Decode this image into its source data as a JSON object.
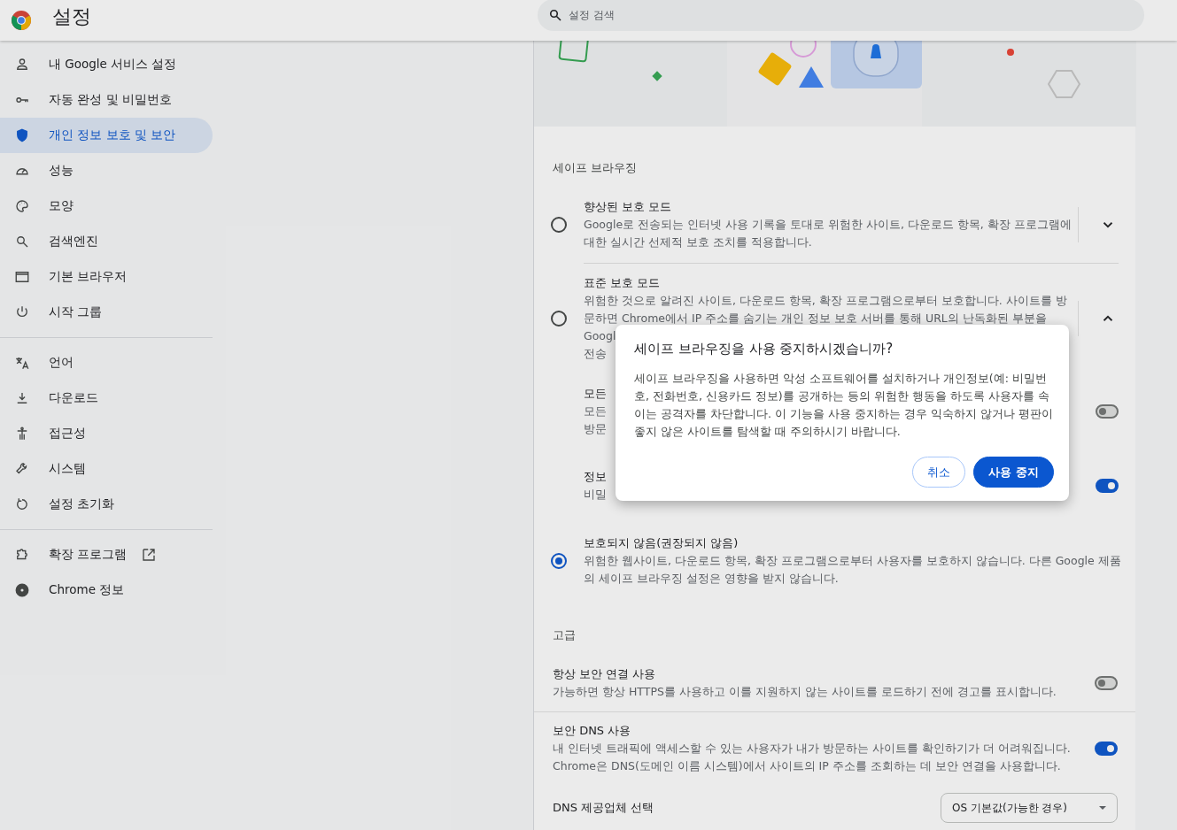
{
  "header": {
    "title": "설정",
    "search": {
      "placeholder": "설정 검색"
    }
  },
  "sidebar": {
    "groups": [
      [
        {
          "label": "내 Google 서비스 설정",
          "selected": false
        },
        {
          "label": "자동 완성 및 비밀번호",
          "selected": false
        },
        {
          "label": "개인 정보 보호 및 보안",
          "selected": true
        },
        {
          "label": "성능",
          "selected": false
        },
        {
          "label": "모양",
          "selected": false
        },
        {
          "label": "검색엔진",
          "selected": false
        },
        {
          "label": "기본 브라우저",
          "selected": false
        },
        {
          "label": "시작 그룹",
          "selected": false
        }
      ],
      [
        {
          "label": "언어",
          "selected": false
        },
        {
          "label": "다운로드",
          "selected": false
        },
        {
          "label": "접근성",
          "selected": false
        },
        {
          "label": "시스템",
          "selected": false
        },
        {
          "label": "설정 초기화",
          "selected": false
        }
      ],
      [
        {
          "label": "확장 프로그램",
          "selected": false,
          "external": true
        },
        {
          "label": "Chrome 정보",
          "selected": false
        }
      ]
    ]
  },
  "safe_browsing": {
    "heading": "세이프 브라우징",
    "options": [
      {
        "title": "향상된 보호 모드",
        "description_lines": [
          "Google로 전송되는 인터넷 사용 기록을 토대로 위험한 사이트, 다운로드 항목, 확장 프로그램에",
          "대한 실시간 선제적 보호 조치를 적용합니다."
        ],
        "selected": false,
        "expanded": false
      },
      {
        "title": "표준 보호 모드",
        "description_lines": [
          "위험한 것으로 알려진 사이트, 다운로드 항목, 확장 프로그램으로부터 보호합니다. 사이트를 방",
          "문하면 Chrome에서 IP 주소를 숨기는 개인 정보 보호 서버를 통해 URL의 난독화된 부분을",
          "Googl",
          "전송"
        ],
        "selected": false,
        "expanded": true,
        "settings": [
          {
            "title": "모든",
            "description_lines": [
              "모든",
              "방문"
            ],
            "on": false
          },
          {
            "title": "정보",
            "description_lines": [
              "비밀"
            ],
            "on": true
          }
        ]
      },
      {
        "title": "보호되지 않음(권장되지 않음)",
        "description_lines": [
          "위험한 웹사이트, 다운로드 항목, 확장 프로그램으로부터 사용자를 보호하지 않습니다. 다른 Google 제품",
          "의 세이프 브라우징 설정은 영향을 받지 않습니다."
        ],
        "selected": true
      }
    ]
  },
  "advanced": {
    "heading": "고급",
    "settings": [
      {
        "title": "항상 보안 연결 사용",
        "description_lines": [
          "가능하면 항상 HTTPS를 사용하고 이를 지원하지 않는 사이트를 로드하기 전에 경고를 표시합니다."
        ],
        "on": false
      },
      {
        "title": "보안 DNS 사용",
        "description_lines": [
          "내 인터넷 트래픽에 액세스할 수 있는 사용자가 내가 방문하는 사이트를 확인하기가 더 어려워집니다.",
          "Chrome은 DNS(도메인 이름 시스템)에서 사이트의 IP 주소를 조회하는 데 보안 연결을 사용합니다."
        ],
        "on": true
      }
    ],
    "dns_provider": {
      "label": "DNS 제공업체 선택",
      "value": "OS 기본값(가능한 경우)"
    }
  },
  "dialog": {
    "title": "세이프 브라우징을 사용 중지하시겠습니까?",
    "body": "세이프 브라우징을 사용하면 악성 소프트웨어를 설치하거나 개인정보(예: 비밀번호, 전화번호, 신용카드 정보)를 공개하는 등의 위험한 행동을 하도록 사용자를 속이는 공격자를 차단합니다. 이 기능을 사용 중지하는 경우 익숙하지 않거나 평판이 좋지 않은 사이트를 탐색할 때 주의하시기 바랍니다.",
    "buttons": [
      {
        "label": "취소",
        "kind": "secondary"
      },
      {
        "label": "사용 중지",
        "kind": "primary"
      }
    ]
  }
}
